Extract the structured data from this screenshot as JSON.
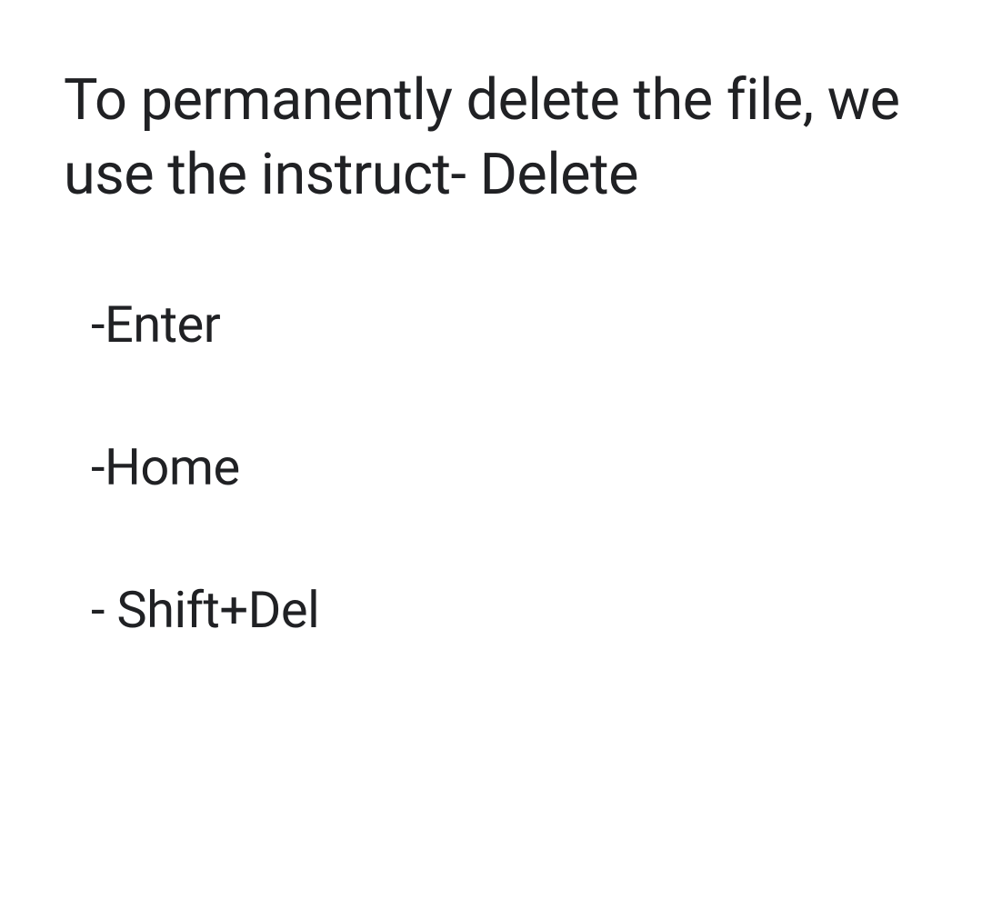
{
  "question": "To permanently delete the file, we use the instruct- Delete",
  "options": [
    "-Enter",
    "-Home",
    "- Shift+Del"
  ]
}
